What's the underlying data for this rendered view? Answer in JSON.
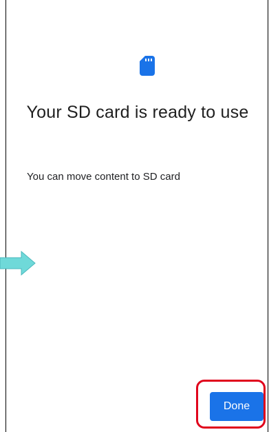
{
  "icons": {
    "sd_card": "sd-card-icon",
    "pointer_arrow": "arrow-right-icon"
  },
  "colors": {
    "accent": "#1a73e8",
    "highlight": "#e0001b",
    "arrow": "#6fd9d9",
    "title_text": "#1f1f1f"
  },
  "screen": {
    "title": "Your SD card is ready to use",
    "message": "You can move content to SD card",
    "done_label": "Done"
  }
}
